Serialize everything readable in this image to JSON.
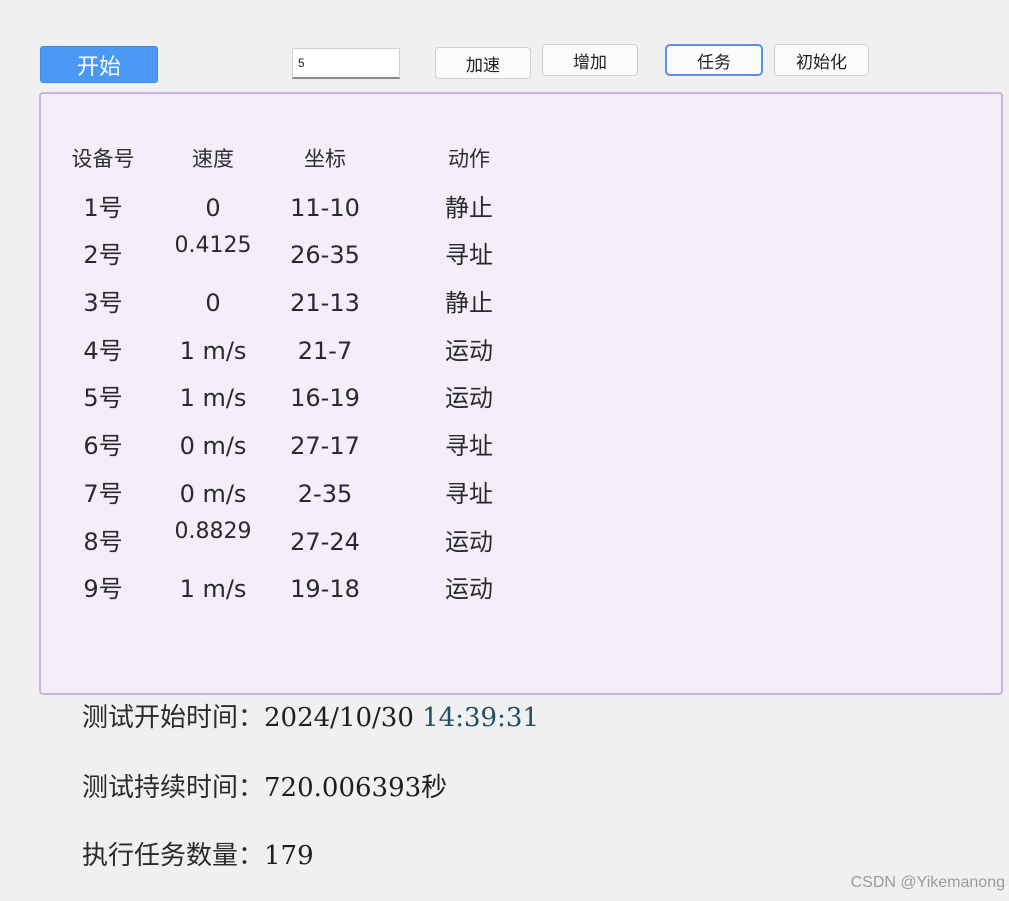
{
  "toolbar": {
    "start_label": "开始",
    "input_value": "5",
    "accelerate_label": "加速",
    "increase_label": "增加",
    "task_label": "任务",
    "init_label": "初始化"
  },
  "table": {
    "headers": {
      "device": "设备号",
      "speed": "速度",
      "coord": "坐标",
      "action": "动作"
    },
    "rows": [
      {
        "device": "1号",
        "speed": "0",
        "coord": "11-10",
        "action": "静止"
      },
      {
        "device": "2号",
        "speed": "0.4125",
        "coord": "26-35",
        "action": "寻址"
      },
      {
        "device": "3号",
        "speed": "0",
        "coord": "21-13",
        "action": "静止"
      },
      {
        "device": "4号",
        "speed": "1 m/s",
        "coord": "21-7",
        "action": "运动"
      },
      {
        "device": "5号",
        "speed": "1 m/s",
        "coord": "16-19",
        "action": "运动"
      },
      {
        "device": "6号",
        "speed": "0 m/s",
        "coord": "27-17",
        "action": "寻址"
      },
      {
        "device": "7号",
        "speed": "0 m/s",
        "coord": "2-35",
        "action": "寻址"
      },
      {
        "device": "8号",
        "speed": "0.8829",
        "coord": "27-24",
        "action": "运动"
      },
      {
        "device": "9号",
        "speed": "1 m/s",
        "coord": "19-18",
        "action": "运动"
      }
    ]
  },
  "summary": {
    "start_time_label": "测试开始时间：",
    "start_date": "2024/10/30",
    "start_time": "14:39:31",
    "duration_label": "测试持续时间：",
    "duration_value": "720.006393秒",
    "task_count_label": "执行任务数量：",
    "task_count_value": "179"
  },
  "watermark": "CSDN @Yikemanong"
}
